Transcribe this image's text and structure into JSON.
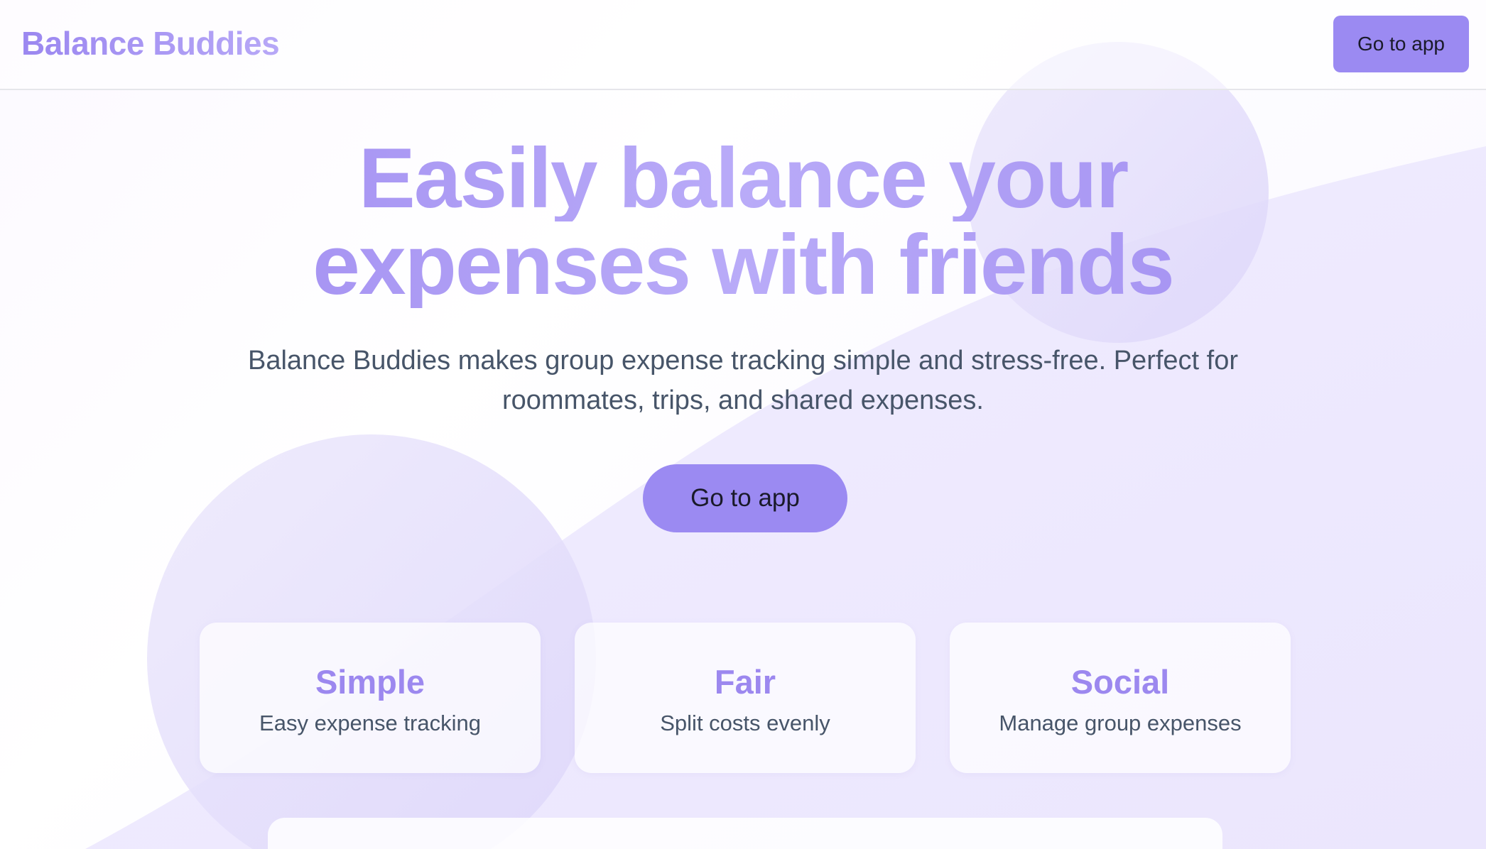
{
  "header": {
    "brand": "Balance Buddies",
    "cta_label": "Go to app"
  },
  "hero": {
    "title_line1": "Easily balance your",
    "title_line2": "expenses with friends",
    "subtitle": "Balance Buddies makes group expense tracking simple and stress-free. Perfect for roommates, trips, and shared expenses.",
    "cta_label": "Go to app"
  },
  "features": [
    {
      "title": "Simple",
      "description": "Easy expense tracking"
    },
    {
      "title": "Fair",
      "description": "Split costs evenly"
    },
    {
      "title": "Social",
      "description": "Manage group expenses"
    }
  ],
  "colors": {
    "accent": "#9b8af2",
    "brand_gradient_start": "#9b87f0",
    "brand_gradient_end": "#b7a8f7",
    "body_text": "#475569"
  }
}
